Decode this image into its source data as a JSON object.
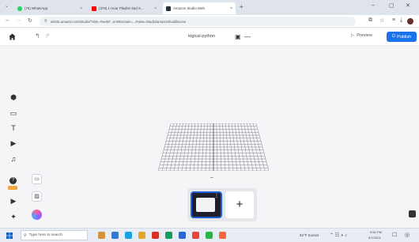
{
  "browser": {
    "tabs": [
      {
        "label": "(75) WhatsApp",
        "color": "#25d366"
      },
      {
        "label": "(379) 1 Hour Playlist Sad S…",
        "color": "#ff0000"
      },
      {
        "label": "Amazon Studio Web",
        "color": "#232f3e"
      }
    ],
    "url": "artistic.amazon.com/studio/?slot=-#web#...ent#Domain=...#view=/studio/amazon/build/scene",
    "new_tab_glyph": "+",
    "close_glyph": "×"
  },
  "app": {
    "project_name": "logical-python",
    "preview_label": "Preview",
    "publish_label": "Publish",
    "accent": "#1a73e8"
  },
  "left_tools": [
    {
      "icon": "objects-icon",
      "glyph": "⬢"
    },
    {
      "icon": "media-icon",
      "glyph": "▭"
    },
    {
      "icon": "text-icon",
      "glyph": "T"
    },
    {
      "icon": "play-icon",
      "glyph": "▶"
    },
    {
      "icon": "music-icon",
      "glyph": "♫"
    },
    {
      "icon": "help-icon",
      "glyph": "?"
    },
    {
      "icon": "video-icon",
      "glyph": "▶"
    },
    {
      "icon": "settings-icon",
      "glyph": "✦"
    }
  ],
  "scenes": {
    "add_glyph": "+"
  },
  "taskbar": {
    "search_placeholder": "Type here to search",
    "weather": "82°F Sunset",
    "time": "9:50 PM",
    "date": "9/7/2024",
    "apps": [
      "#d0943c",
      "#2b7bd6",
      "#1ba1e2",
      "#e2a62b",
      "#d93025",
      "#0f9d58",
      "#2d66d4",
      "#e8453c",
      "#2db34a",
      "#f2683d"
    ]
  }
}
